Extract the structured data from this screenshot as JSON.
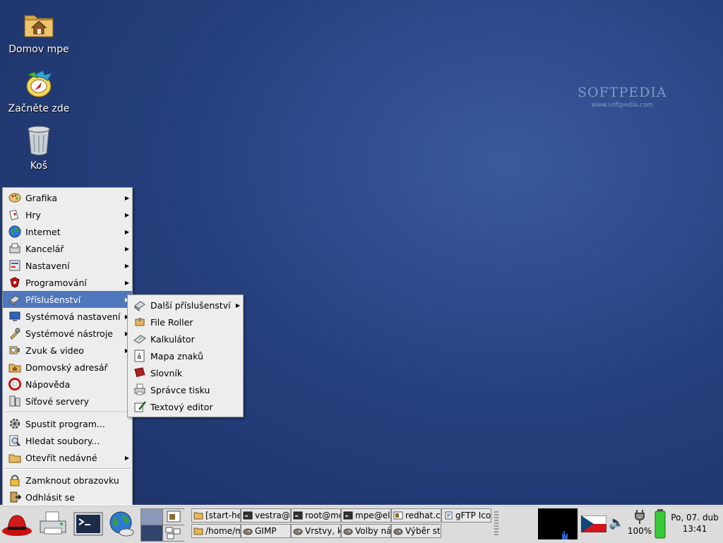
{
  "desktop": {
    "icons": [
      {
        "label": "Domov mpe",
        "icon": "home-folder-icon"
      },
      {
        "label": "Začněte zde",
        "icon": "start-here-icon"
      },
      {
        "label": "Koš",
        "icon": "trash-icon"
      }
    ],
    "watermark": {
      "brand": "SOFTPEDIA",
      "url": "www.softpedia.com"
    }
  },
  "main_menu": {
    "items": [
      {
        "label": "Grafika",
        "icon": "graphics-icon",
        "submenu": true
      },
      {
        "label": "Hry",
        "icon": "games-icon",
        "submenu": true
      },
      {
        "label": "Internet",
        "icon": "internet-globe-icon",
        "submenu": true
      },
      {
        "label": "Kancelář",
        "icon": "office-icon",
        "submenu": true
      },
      {
        "label": "Nastavení",
        "icon": "preferences-icon",
        "submenu": true
      },
      {
        "label": "Programování",
        "icon": "programming-icon",
        "submenu": true
      },
      {
        "label": "Příslušenství",
        "icon": "accessories-icon",
        "submenu": true,
        "active": true
      },
      {
        "label": "Systémová nastavení",
        "icon": "system-settings-icon",
        "submenu": true
      },
      {
        "label": "Systémové nástroje",
        "icon": "system-tools-icon",
        "submenu": true
      },
      {
        "label": "Zvuk & video",
        "icon": "sound-video-icon",
        "submenu": true
      },
      {
        "label": "Domovský adresář",
        "icon": "home-folder-icon",
        "submenu": false
      },
      {
        "label": "Nápověda",
        "icon": "help-icon",
        "submenu": false
      },
      {
        "label": "Síťové servery",
        "icon": "network-servers-icon",
        "submenu": false
      }
    ],
    "actions": [
      {
        "label": "Spustit program...",
        "icon": "run-program-icon",
        "submenu": false
      },
      {
        "label": "Hledat soubory...",
        "icon": "search-files-icon",
        "submenu": false
      },
      {
        "label": "Otevřít nedávné",
        "icon": "recent-folder-icon",
        "submenu": true
      }
    ],
    "session": [
      {
        "label": "Zamknout obrazovku",
        "icon": "lock-icon"
      },
      {
        "label": "Odhlásit se",
        "icon": "logout-icon"
      }
    ]
  },
  "accessories_menu": {
    "items": [
      {
        "label": "Další příslušenství",
        "icon": "more-accessories-icon",
        "submenu": true
      },
      {
        "label": "File Roller",
        "icon": "file-roller-icon",
        "submenu": false
      },
      {
        "label": "Kalkulátor",
        "icon": "calculator-icon",
        "submenu": false
      },
      {
        "label": "Mapa znaků",
        "icon": "character-map-icon",
        "submenu": false
      },
      {
        "label": "Slovník",
        "icon": "dictionary-icon",
        "submenu": false
      },
      {
        "label": "Správce tisku",
        "icon": "print-manager-icon",
        "submenu": false
      },
      {
        "label": "Textový editor",
        "icon": "text-editor-icon",
        "submenu": false
      }
    ]
  },
  "panel": {
    "launchers": [
      {
        "name": "redhat-menu-icon"
      },
      {
        "name": "printer-icon"
      },
      {
        "name": "terminal-icon"
      },
      {
        "name": "web-browser-icon"
      }
    ],
    "tasks_row1": [
      {
        "label": "[start-he",
        "icon": "folder-icon"
      },
      {
        "label": "vestra@",
        "icon": "terminal-icon"
      },
      {
        "label": "root@mo",
        "icon": "terminal-icon"
      },
      {
        "label": "mpe@el",
        "icon": "terminal-icon"
      },
      {
        "label": "redhat.co",
        "icon": "image-icon"
      },
      {
        "label": "gFTP Ico",
        "icon": "document-icon"
      }
    ],
    "tasks_row2": [
      {
        "label": "/home/m",
        "icon": "folder-icon"
      },
      {
        "label": "GIMP",
        "icon": "gimp-icon"
      },
      {
        "label": "Vrstvy, k",
        "icon": "gimp-icon"
      },
      {
        "label": "Volby ná",
        "icon": "gimp-icon"
      },
      {
        "label": "Výběr st",
        "icon": "gimp-icon"
      }
    ],
    "battery_percent": "100%",
    "clock_date": "Po, 07. dub",
    "clock_time": "13:41"
  },
  "colors": {
    "menu_highlight": "#4f77bd",
    "desktop_bg": "#26407d",
    "panel_bg": "#dcdcdc"
  }
}
